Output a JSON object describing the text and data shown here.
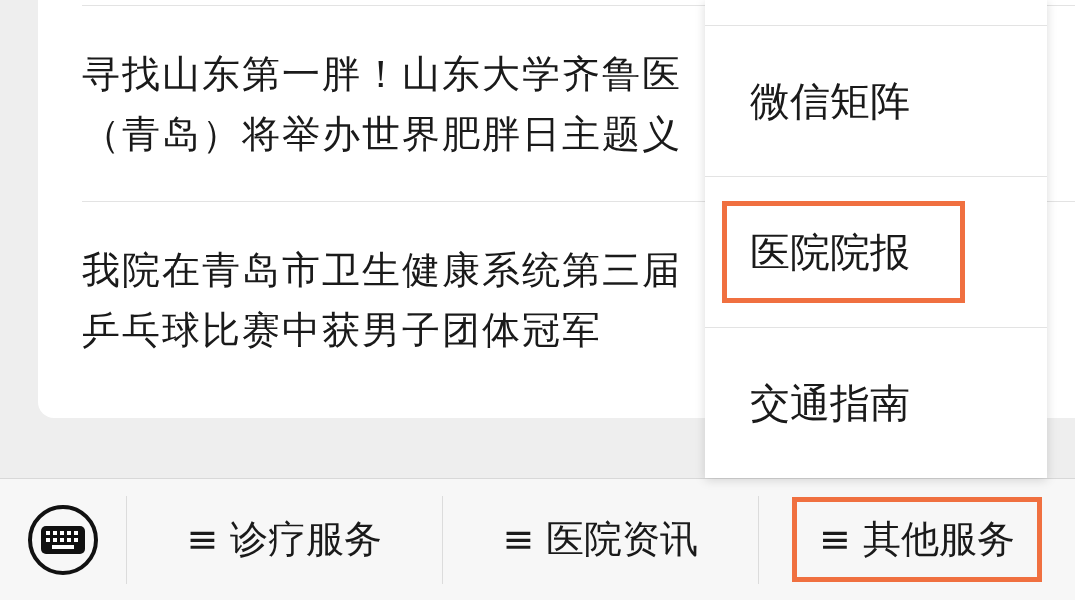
{
  "articles": [
    {
      "lines": [
        "寻找山东第一胖！山东大学齐鲁医",
        "（青岛）将举办世界肥胖日主题义"
      ]
    },
    {
      "lines": [
        "我院在青岛市卫生健康系统第三届",
        "乒乓球比赛中获男子团体冠军"
      ]
    }
  ],
  "popup_menu": {
    "items": [
      {
        "label": "微信矩阵",
        "highlighted": false
      },
      {
        "label": "医院院报",
        "highlighted": true
      },
      {
        "label": "交通指南",
        "highlighted": false
      }
    ]
  },
  "bottom_bar": {
    "tabs": [
      {
        "label": "≡ 诊疗服务",
        "highlighted": false
      },
      {
        "label": "≡ 医院资讯",
        "highlighted": false
      },
      {
        "label": "≡ 其他服务",
        "highlighted": true
      }
    ]
  }
}
